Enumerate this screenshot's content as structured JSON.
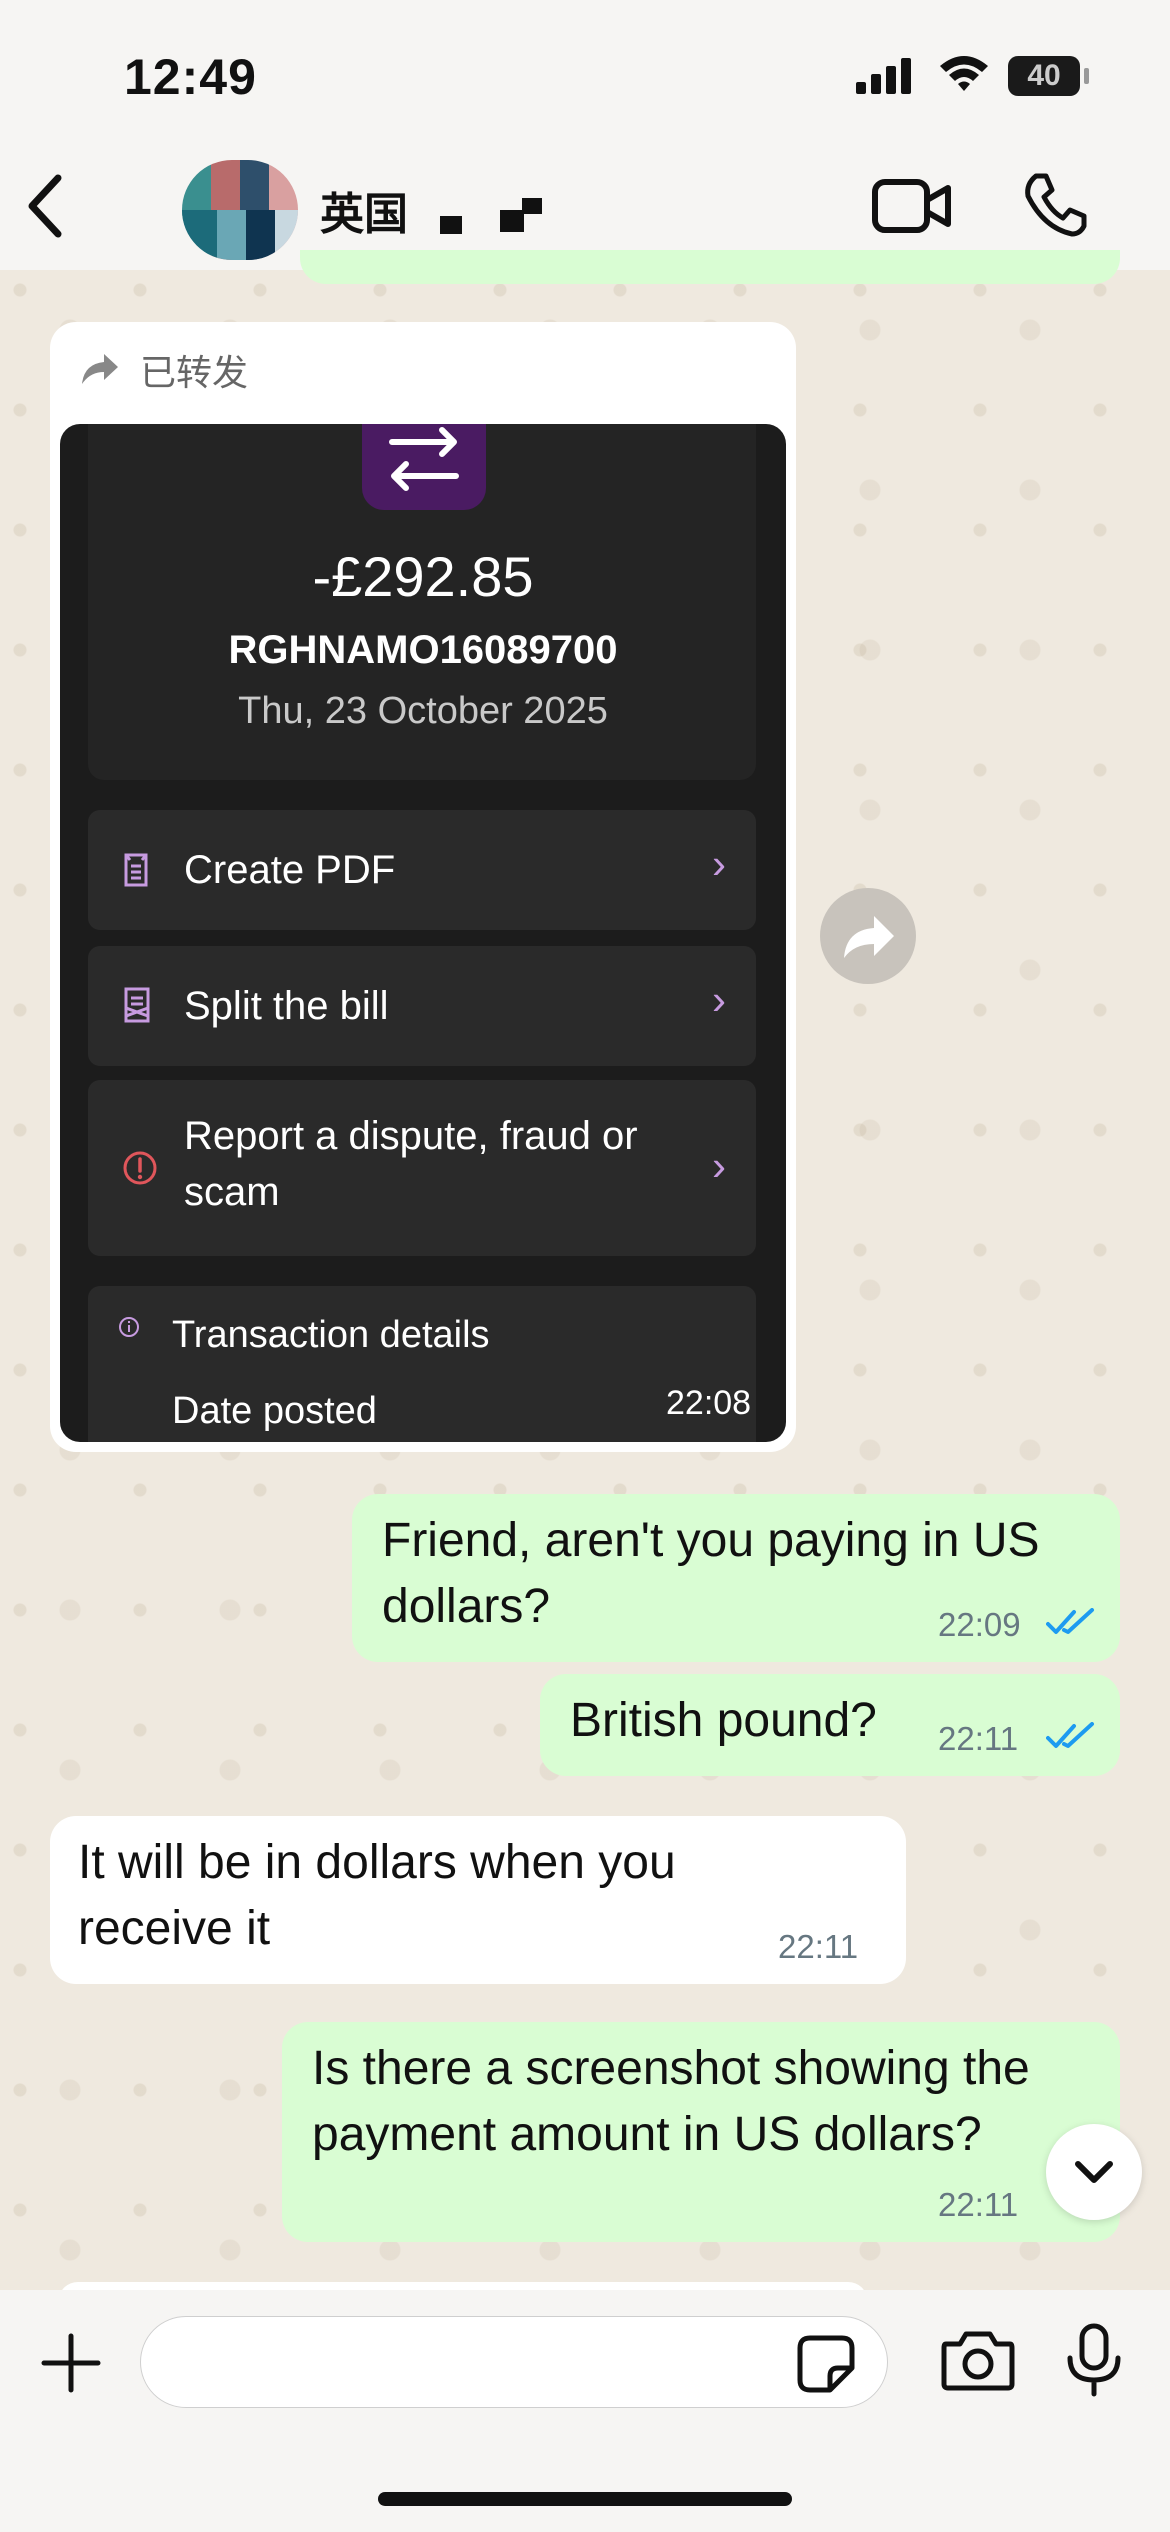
{
  "status_bar": {
    "time": "12:49",
    "battery": "40"
  },
  "header": {
    "back_icon": "chevron-left-icon",
    "contact_name": "英国",
    "video_icon": "video-camera-icon",
    "call_icon": "phone-icon"
  },
  "forwarded_message": {
    "forwarded_label": "已转发",
    "card": {
      "amount": "-£292.85",
      "reference": "RGHNAMO16089700",
      "date": "Thu, 23 October 2025",
      "actions": [
        {
          "label": "Create PDF",
          "icon": "document-icon"
        },
        {
          "label": "Split the bill",
          "icon": "split-receipt-icon"
        },
        {
          "label": "Report a dispute, fraud or scam",
          "icon": "alert-circle-icon"
        }
      ],
      "details_title": "Transaction details",
      "details_row": "Date posted"
    },
    "time": "22:08"
  },
  "messages": [
    {
      "direction": "out",
      "text": "Friend, aren't you paying in US dollars?",
      "time": "22:09",
      "status": "read"
    },
    {
      "direction": "out",
      "text": "British pound?",
      "time": "22:11",
      "status": "read"
    },
    {
      "direction": "in",
      "text": "It will be in dollars  when you receive it",
      "time": "22:11"
    },
    {
      "direction": "out",
      "text": "Is there a screenshot showing the payment amount in US dollars?",
      "time": "22:11",
      "status": "read"
    }
  ],
  "composer": {
    "placeholder": "",
    "value": ""
  },
  "colors": {
    "outgoing_bubble": "#d9fdd3",
    "incoming_bubble": "#ffffff",
    "read_ticks": "#1d9bf0",
    "chat_background": "#efe9df"
  }
}
